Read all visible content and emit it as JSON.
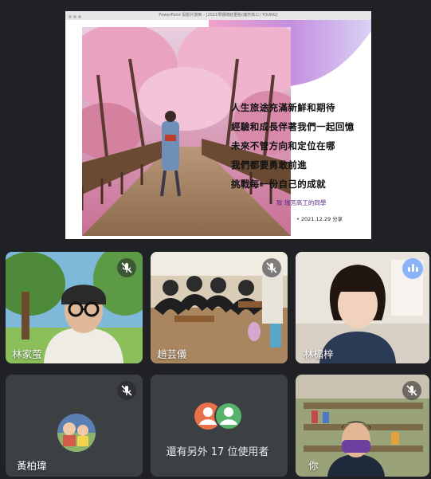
{
  "window": {
    "title": "PowerPoint 投影片放映 - [2021學期總結重點(瑞芳高工) YOUNG]"
  },
  "slide": {
    "lines": [
      "人生旅途充滿新鮮和期待",
      "經驗和成長伴著我們一起回憶",
      "未來不管方向和定位在哪",
      "我們都要勇敢前進",
      "挑戰每一份自己的成就"
    ],
    "signature": "致 瑞芳高工的同學",
    "date": "• 2021.12.29 分享"
  },
  "participants": [
    {
      "name": "林家萤",
      "muted": true,
      "speaking": false
    },
    {
      "name": "趙芸儀",
      "muted": true,
      "speaking": false
    },
    {
      "name": "林楣梓",
      "muted": false,
      "speaking": true
    },
    {
      "name": "黃柏瑋",
      "muted": true,
      "speaking": false
    },
    {
      "name": "你",
      "muted": true,
      "speaking": false
    }
  ],
  "others": {
    "text": "還有另外 17 位使用者"
  },
  "colors": {
    "background": "#202124",
    "tile": "#3c4043",
    "active_speaker_border": "#8ab4f8",
    "avatar_orange": "#e8704a",
    "avatar_green": "#55b36b"
  },
  "icons": {
    "mute": "mic-off-icon",
    "speaking": "audio-level-icon"
  }
}
